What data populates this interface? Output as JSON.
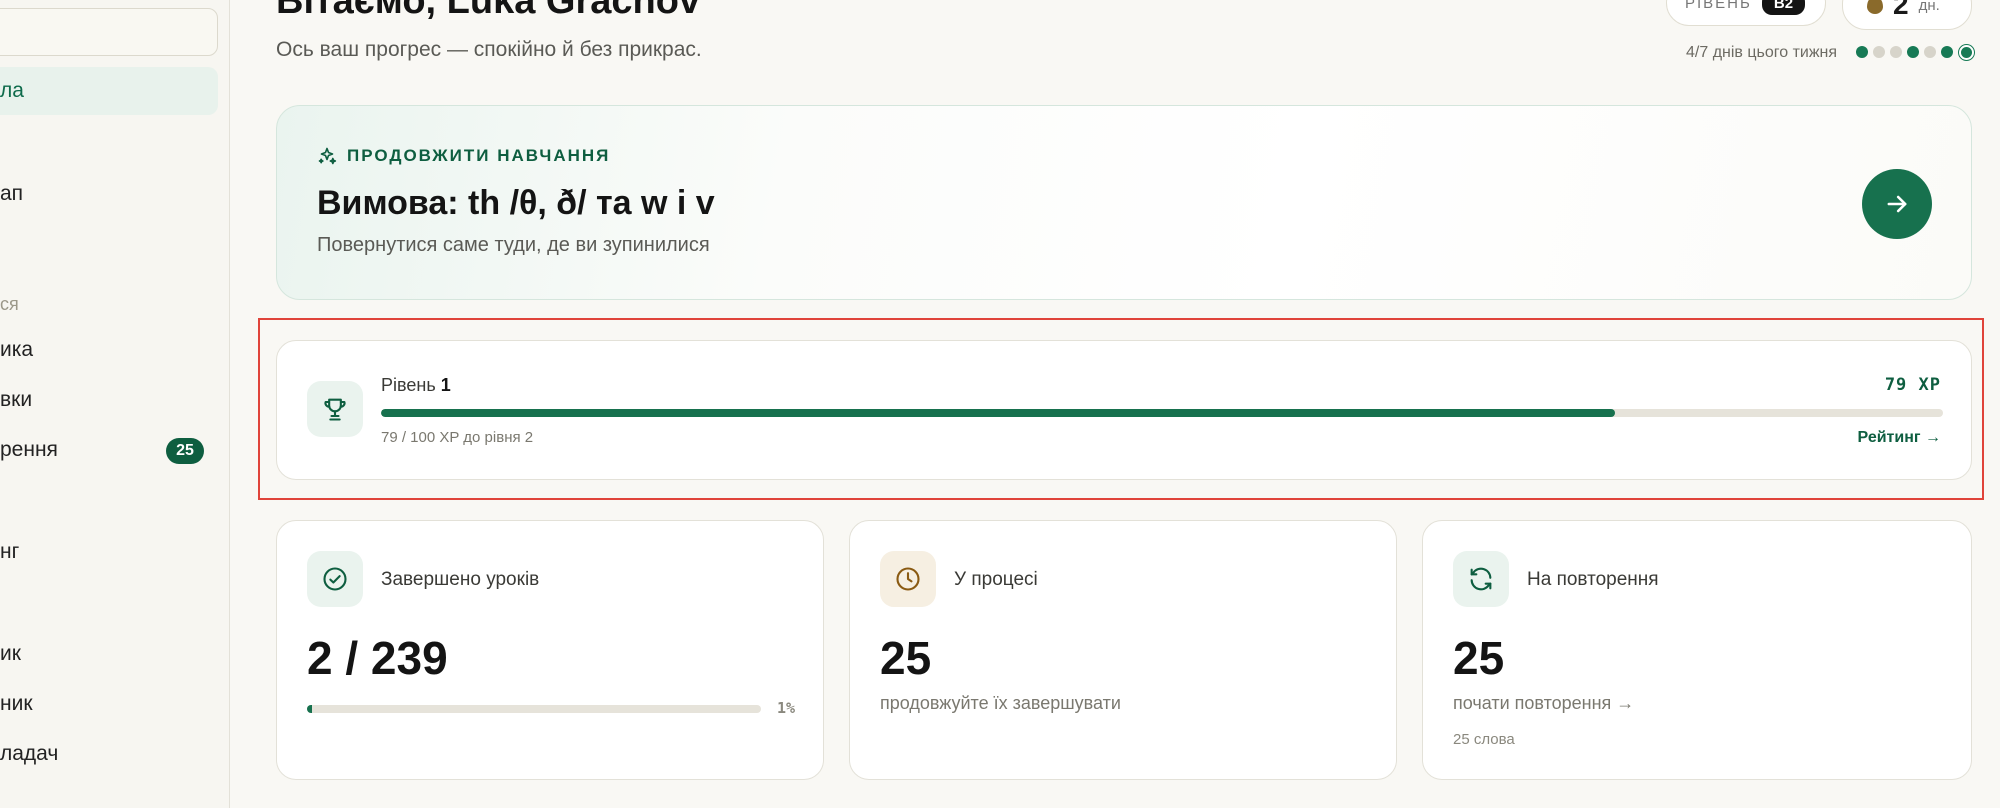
{
  "sidebar": {
    "items": [
      {
        "label": "ла"
      },
      {
        "label": "ап"
      },
      {
        "label": "ика"
      },
      {
        "label": "вки"
      },
      {
        "label": "рення"
      },
      {
        "label": "нг"
      },
      {
        "label": "ик"
      },
      {
        "label": "ник"
      },
      {
        "label": "ладач"
      }
    ],
    "section_label": "ся",
    "review_badge": "25"
  },
  "header": {
    "title": "Вітаємо, Luka Grachov",
    "subtitle": "Ось ваш прогрес — спокійно й без прикрас.",
    "level_label": "РІВЕНЬ",
    "level_value": "B2",
    "streak_value": "2",
    "streak_unit": "дн.",
    "week_text": "4/7 днів цього тижня",
    "week_days": [
      true,
      false,
      false,
      true,
      false,
      true,
      true
    ]
  },
  "continue": {
    "eyebrow": "ПРОДОВЖИТИ НАВЧАННЯ",
    "title": "Вимова: th /θ, ð/ та w і v",
    "subtitle": "Повернутися саме туди, де ви зупинилися"
  },
  "level_card": {
    "label": "Рівень",
    "level": "1",
    "xp_text": "79 XP",
    "progress_fraction": 0.79,
    "note": "79 / 100 XP до рівня 2",
    "link": "Рейтинг →"
  },
  "stats": [
    {
      "name": "Завершено уроків",
      "value": "2 / 239",
      "progress_fraction": 0.01,
      "percent": "1%"
    },
    {
      "name": "У процесі",
      "value": "25",
      "desc": "продовжуйте їх завершувати"
    },
    {
      "name": "На повторення",
      "value": "25",
      "desc": "почати повторення →",
      "desc2": "25 слова"
    }
  ],
  "colors": {
    "accent": "#17714e",
    "highlight": "#e0443a"
  }
}
